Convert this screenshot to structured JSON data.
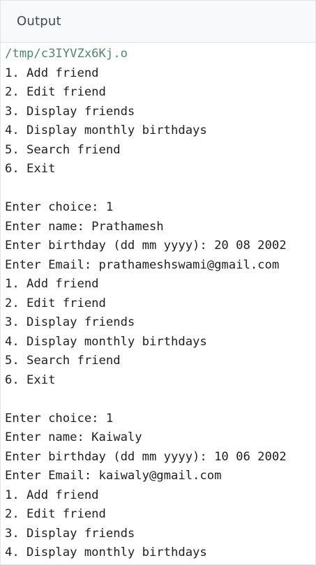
{
  "header": {
    "title": "Output"
  },
  "console": {
    "path": "/tmp/c3IYVZx6Kj.o",
    "lines": [
      "1. Add friend",
      "2. Edit friend",
      "3. Display friends",
      "4. Display monthly birthdays",
      "5. Search friend",
      "6. Exit",
      "",
      "Enter choice: 1",
      "Enter name: Prathamesh",
      "Enter birthday (dd mm yyyy): 20 08 2002",
      "Enter Email: prathameshswami@gmail.com",
      "1. Add friend",
      "2. Edit friend",
      "3. Display friends",
      "4. Display monthly birthdays",
      "5. Search friend",
      "6. Exit",
      "",
      "Enter choice: 1",
      "Enter name: Kaiwaly",
      "Enter birthday (dd mm yyyy): 10 06 2002",
      "Enter Email: kaiwaly@gmail.com",
      "1. Add friend",
      "2. Edit friend",
      "3. Display friends",
      "4. Display monthly birthdays"
    ]
  }
}
